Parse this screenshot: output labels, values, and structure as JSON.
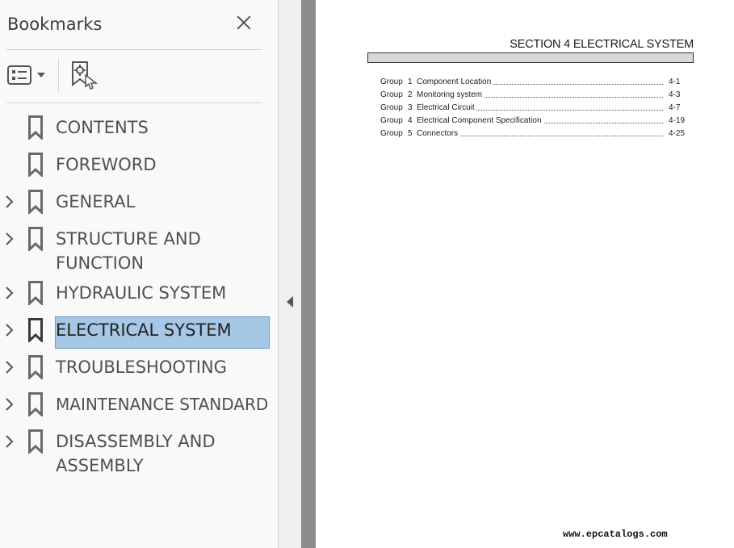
{
  "bookmarks_panel": {
    "title": "Bookmarks",
    "close_icon": "close-icon",
    "options_icon": "list-options-icon",
    "find_icon": "find-bookmark-icon",
    "items": [
      {
        "label": "CONTENTS",
        "expandable": false,
        "selected": false
      },
      {
        "label": "FOREWORD",
        "expandable": false,
        "selected": false
      },
      {
        "label": "GENERAL",
        "expandable": true,
        "selected": false
      },
      {
        "label": "STRUCTURE AND FUNCTION",
        "expandable": true,
        "selected": false
      },
      {
        "label": "HYDRAULIC SYSTEM",
        "expandable": true,
        "selected": false
      },
      {
        "label": "ELECTRICAL SYSTEM",
        "expandable": true,
        "selected": true
      },
      {
        "label": "TROUBLESHOOTING",
        "expandable": true,
        "selected": false
      },
      {
        "label": "MAINTENANCE STANDARD",
        "expandable": true,
        "selected": false
      },
      {
        "label": "DISASSEMBLY AND ASSEMBLY",
        "expandable": true,
        "selected": false
      }
    ]
  },
  "document": {
    "section_title": "SECTION  4  ELECTRICAL SYSTEM",
    "toc": [
      {
        "group": "Group",
        "num": "1",
        "title": "Component Location",
        "page": "4-1"
      },
      {
        "group": "Group",
        "num": "2",
        "title": "Monitoring system",
        "page": "4-3"
      },
      {
        "group": "Group",
        "num": "3",
        "title": "Electrical Circuit",
        "page": "4-7"
      },
      {
        "group": "Group",
        "num": "4",
        "title": "Electrical Component Specification",
        "page": "4-19"
      },
      {
        "group": "Group",
        "num": "5",
        "title": "Connectors",
        "page": "4-25"
      }
    ],
    "footer_url": "www.epcatalogs.com"
  },
  "colors": {
    "selected_bg": "#a7c7e7",
    "selected_border": "#6b9bc9",
    "panel_bg": "#f9f9f9",
    "page_gutter": "#8c8c8c"
  }
}
